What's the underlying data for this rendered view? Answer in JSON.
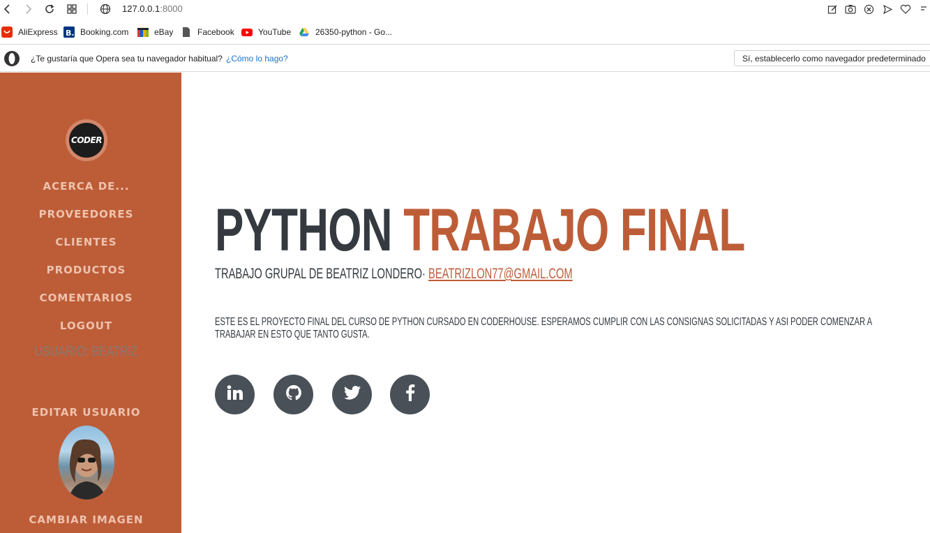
{
  "browser": {
    "url_host": "127.0.0.1",
    "url_port": ":8000",
    "bookmarks": [
      {
        "label": "AliExpress",
        "icon": "aliexpress-icon",
        "color": "#e62e04"
      },
      {
        "label": "Booking.com",
        "icon": "booking-icon",
        "color": "#003580"
      },
      {
        "label": "eBay",
        "icon": "ebay-icon",
        "color": "#e53238"
      },
      {
        "label": "Facebook",
        "icon": "document-icon",
        "color": "#555555"
      },
      {
        "label": "YouTube",
        "icon": "youtube-icon",
        "color": "#ff0000"
      },
      {
        "label": "26350-python - Go...",
        "icon": "google-drive-icon",
        "color": "#1fa463"
      }
    ],
    "default_prompt": {
      "question": "¿Te gustaría que Opera sea tu navegador habitual?",
      "how_link": "¿Cómo lo hago?",
      "set_default_button": "Sí, establecerlo como navegador predeterminado"
    }
  },
  "sidebar": {
    "logo_text": "CODER",
    "nav": [
      "ACERCA DE...",
      "PROVEEDORES",
      "CLIENTES",
      "PRODUCTOS",
      "COMENTARIOS",
      "LOGOUT"
    ],
    "user_label": "USUARIO: BEATRIZ",
    "edit_user": "EDITAR USUARIO",
    "change_image": "CAMBIAR IMAGEN"
  },
  "main": {
    "title_dark": "PYTHON",
    "title_accent": "TRABAJO FINAL",
    "subtitle_text": "TRABAJO GRUPAL DE BEATRIZ LONDERO·",
    "subtitle_email": "BEATRIZLON77@GMAIL.COM",
    "description": "ESTE ES EL PROYECTO FINAL DEL CURSO DE PYTHON CURSADO EN CODERHOUSE. ESPERAMOS CUMPLIR CON LAS CONSIGNAS SOLICITADAS Y ASI PODER COMENZAR A TRABAJAR EN ESTO QUE TANTO GUSTA.",
    "social_icons": [
      "linkedin-icon",
      "github-icon",
      "twitter-icon",
      "facebook-icon"
    ]
  },
  "colors": {
    "accent": "#bd5d38",
    "dark": "#343a40",
    "social_bg": "#495057",
    "nav_text": "#efc2ad"
  }
}
